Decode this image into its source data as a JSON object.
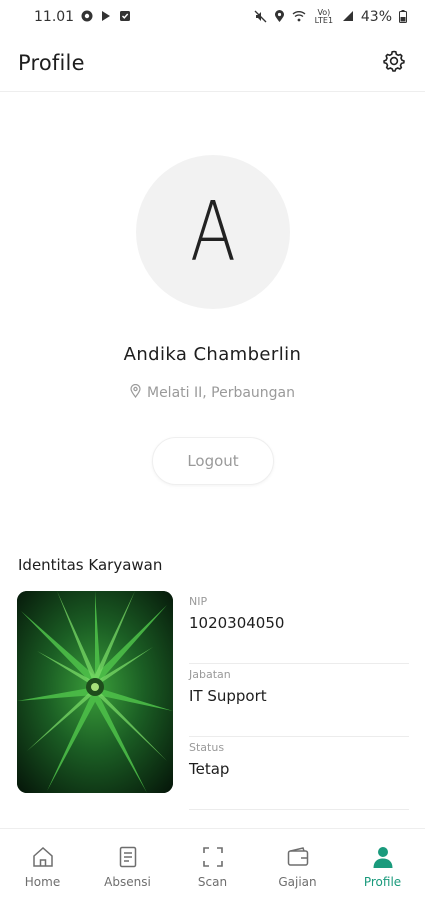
{
  "status_bar": {
    "time": "11.01",
    "network_text": "Vo) LTE1",
    "battery": "43%",
    "left_icons": [
      "chrome-icon",
      "play-store-icon",
      "task-icon"
    ],
    "right_icons": [
      "mute-icon",
      "location-icon",
      "wifi-icon",
      "signal-icon",
      "battery-icon"
    ]
  },
  "app_bar": {
    "title": "Profile",
    "settings_icon": "gear-icon"
  },
  "profile": {
    "avatar_initial": "A",
    "name": "Andika Chamberlin",
    "location": "Melati II, Perbaungan",
    "logout_label": "Logout"
  },
  "employee": {
    "section_title": "Identitas Karyawan",
    "fields": [
      {
        "label": "NIP",
        "value": "1020304050"
      },
      {
        "label": "Jabatan",
        "value": "IT Support"
      },
      {
        "label": "Status",
        "value": "Tetap"
      }
    ]
  },
  "nav": {
    "active": "Profile",
    "accent_color": "#1a9a7c",
    "items": [
      {
        "label": "Home",
        "icon": "home-icon"
      },
      {
        "label": "Absensi",
        "icon": "document-icon"
      },
      {
        "label": "Scan",
        "icon": "scan-icon"
      },
      {
        "label": "Gajian",
        "icon": "wallet-icon"
      },
      {
        "label": "Profile",
        "icon": "person-icon"
      }
    ]
  }
}
